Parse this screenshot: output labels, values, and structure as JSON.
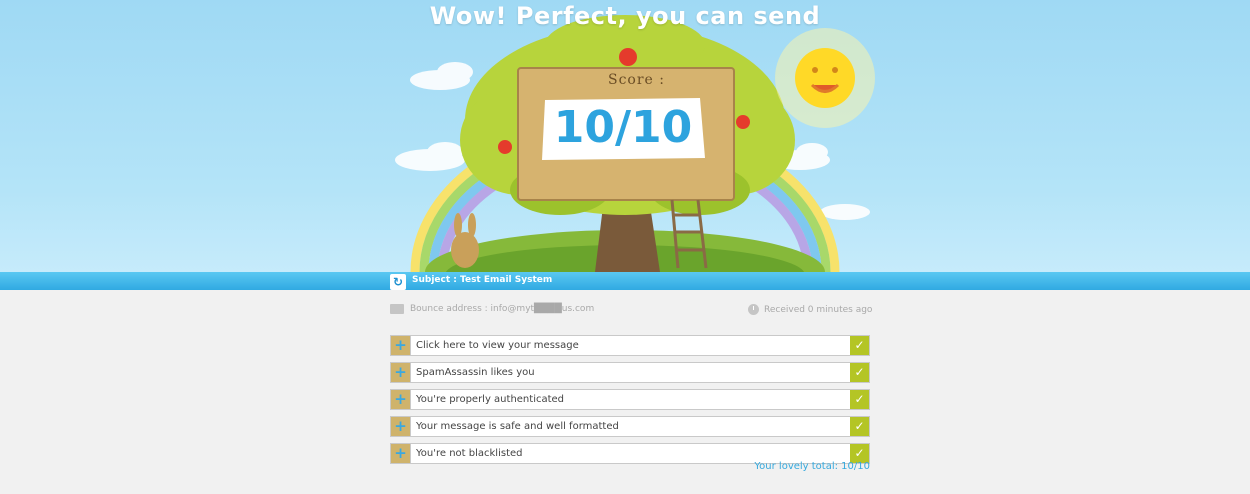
{
  "hero": {
    "title": "Wow! Perfect, you can send",
    "score_label": "Score :",
    "score_value": "10/10"
  },
  "header_bar": {
    "subject": "Subject : Test Email System"
  },
  "meta": {
    "bounce": "Bounce address : info@myt████us.com",
    "received": "Received 0 minutes ago"
  },
  "checks": [
    {
      "label": "Click here to view your message"
    },
    {
      "label": "SpamAssassin likes you"
    },
    {
      "label": "You're properly authenticated"
    },
    {
      "label": "Your message is safe and well formatted"
    },
    {
      "label": "You're not blacklisted"
    }
  ],
  "total": "Your lovely total: 10/10",
  "icons": {
    "refresh": "refresh-icon",
    "mail": "mail-icon",
    "clock": "clock-icon",
    "expand": "plus-icon",
    "check": "check-icon"
  },
  "colors": {
    "accent": "#35a9de",
    "check_green": "#b4c525",
    "sky": "#b4e4f8"
  }
}
